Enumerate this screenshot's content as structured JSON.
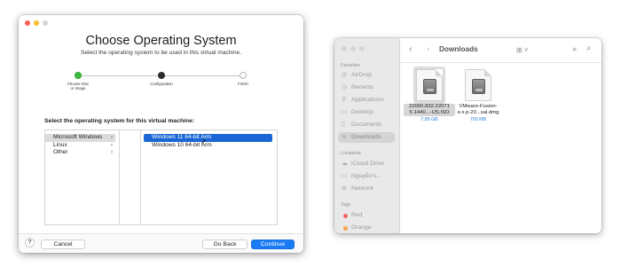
{
  "wizard": {
    "title": "Choose Operating System",
    "subtitle": "Select the operating system to be used in this virtual machine.",
    "steps": [
      {
        "label_line1": "Choose Disc",
        "label_line2": "or Image",
        "status": "done"
      },
      {
        "label_line1": "Configuration",
        "label_line2": "",
        "status": "current"
      },
      {
        "label_line1": "Finish",
        "label_line2": "",
        "status": "pending"
      }
    ],
    "prompt": "Select the operating system for this virtual machine:",
    "os_categories": [
      {
        "label": "Microsoft Windows",
        "selected": true,
        "chevron": "›"
      },
      {
        "label": "Linux",
        "selected": false,
        "chevron": "›"
      },
      {
        "label": "Other",
        "selected": false,
        "chevron": "›"
      }
    ],
    "os_versions": [
      {
        "label": "Windows 11 64-bit Arm",
        "selected": true
      },
      {
        "label": "Windows 10 64-bit Arm",
        "selected": false
      }
    ],
    "footer": {
      "help": "?",
      "cancel": "Cancel",
      "go_back": "Go Back",
      "continue": "Continue"
    },
    "accent_color": "#1a7cf5"
  },
  "finder": {
    "title": "Downloads",
    "sections": {
      "favorites": "Favorites",
      "locations": "Locations",
      "tags": "Tags"
    },
    "favorites": [
      {
        "label": "AirDrop",
        "icon": "airdrop-icon",
        "selected": false
      },
      {
        "label": "Recents",
        "icon": "clock-icon",
        "selected": false
      },
      {
        "label": "Applications",
        "icon": "applications-icon",
        "selected": false
      },
      {
        "label": "Desktop",
        "icon": "desktop-icon",
        "selected": false
      },
      {
        "label": "Documents",
        "icon": "document-icon",
        "selected": false
      },
      {
        "label": "Downloads",
        "icon": "downloads-icon",
        "selected": true
      }
    ],
    "locations": [
      {
        "label": "iCloud Drive",
        "icon": "cloud-icon"
      },
      {
        "label": "Nguyễn's...",
        "icon": "laptop-icon"
      },
      {
        "label": "Network",
        "icon": "network-icon"
      }
    ],
    "tags": [
      {
        "label": "Red",
        "color": "#f0645c"
      },
      {
        "label": "Orange",
        "color": "#f5a34a"
      }
    ],
    "files": [
      {
        "name_line1": "22000.832.22071",
        "name_line2": "5-1440...-US.ISO",
        "size": "7,89 GB",
        "selected": true
      },
      {
        "name_line1": "VMware-Fusion-",
        "name_line2": "e.x.p-20...sal.dmg",
        "size": "700 MB",
        "selected": false
      }
    ]
  }
}
